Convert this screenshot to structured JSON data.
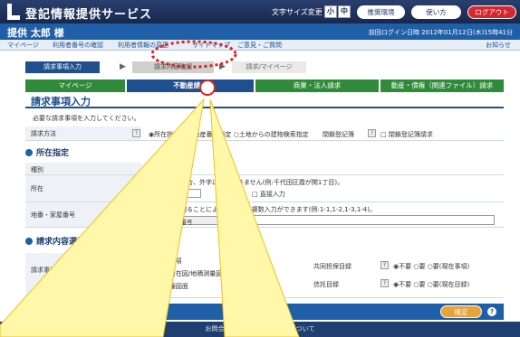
{
  "header": {
    "app_title": "登記情報提供サービス",
    "font_size_label": "文字サイズ変更",
    "font_sizes": [
      "小",
      "中",
      "大"
    ],
    "env_button": "推奨環境",
    "help_button": "使い方",
    "logout_button": "ログアウト"
  },
  "userbar": {
    "username": "提供 太郎 様",
    "last_login": "前回ログイン日時 2012年01月12日(木)15時41分"
  },
  "links": {
    "items": [
      "マイページ",
      "利用者番号の確認",
      "利用者情報の変更",
      "サイトマップ",
      "ご意見・ご質問"
    ],
    "exit": "お知らせ"
  },
  "steps": [
    "請求事項入力",
    "請求内容確認",
    "請求/マイページ"
  ],
  "tabs": [
    "マイページ",
    "不動産請求",
    "商業・法人請求",
    "動産・債権（関連ファイル）請求"
  ],
  "section_title": "請求事項入力",
  "note": "必要な請求事項を入力してください。",
  "form": {
    "method_label": "請求方法",
    "method_options": "◉所在指定 ○不動産番号指定 ○土地からの建物検索指定",
    "cross_label": "閉鎖登記簿",
    "cross_value": "□ 閉鎖登記簿請求",
    "location_heading": "所在指定",
    "kind_label": "種別",
    "kind_options": "◉土地 ○建物",
    "address_label": "所在",
    "address_hint": "直接入力の場合、外字は入力できません(例:千代田区霞が関1丁目)。",
    "prefecture_placeholder": "都道府県",
    "direct_input": "□ 直接入力",
    "lot_label": "地番・家屋番号",
    "lot_hint": "カンマで区切ることにより10件まで複数入力ができます(例:1-1,1-2,1-3,1-4)。",
    "lot_button": "地番・家屋番号",
    "content_heading": "請求内容選択",
    "type_label": "請求事項の種類(複数選択可能)",
    "type_options": [
      "☑ 全部事項",
      "□ 土地所在図/地積測量図",
      "□ 地役権図面"
    ],
    "joint_label": "共同担保目録",
    "joint_options": "◉不要 ○要 ○要(現在事項)",
    "trust_label": "信託目録",
    "trust_options": "◉不要 ○要 ○要(現在目録)"
  },
  "buttons": {
    "clear": "クリア",
    "confirm": "確定"
  },
  "footer": "お問合せ 個人情報の取り扱いについて"
}
